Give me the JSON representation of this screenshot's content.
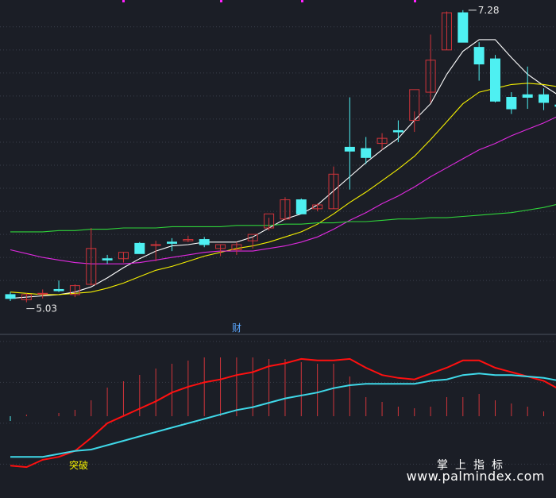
{
  "colors": {
    "background": "#1b1e26",
    "grid": "#3a3f4b",
    "up": "#d1343a",
    "down": "#4ef0f2",
    "ma5": "#ffffff",
    "ma10": "#f5f000",
    "ma20": "#e02ae0",
    "ma60": "#2fd43a",
    "osc_fast": "#ff1010",
    "osc_slow": "#3fd8e8",
    "hist": "#d1343a",
    "marker": "#ff22ff",
    "label": "#e8e8e8",
    "signal": "#f5f000",
    "divider_text": "#5aa7ff"
  },
  "annotations": {
    "high_label": "7.28",
    "low_label": "5.03",
    "finance_marker": "财",
    "signal_label": "突破"
  },
  "watermark": {
    "title": "掌上指标",
    "url": "www.palmindex.com"
  },
  "chart_data": [
    {
      "type": "candlestick",
      "title": "",
      "ylim": [
        4.85,
        7.33
      ],
      "y_gridlines": [
        5.19,
        5.37,
        5.55,
        5.73,
        5.91,
        6.09,
        6.27,
        6.45,
        6.63,
        6.81,
        6.99,
        7.17
      ],
      "candles": [
        {
          "o": 5.08,
          "h": 5.1,
          "l": 5.03,
          "c": 5.05
        },
        {
          "o": 5.04,
          "h": 5.09,
          "l": 5.02,
          "c": 5.08
        },
        {
          "o": 5.09,
          "h": 5.12,
          "l": 5.05,
          "c": 5.09
        },
        {
          "o": 5.12,
          "h": 5.19,
          "l": 5.1,
          "c": 5.11
        },
        {
          "o": 5.08,
          "h": 5.16,
          "l": 5.06,
          "c": 5.15
        },
        {
          "o": 5.16,
          "h": 5.6,
          "l": 5.15,
          "c": 5.44
        },
        {
          "o": 5.36,
          "h": 5.39,
          "l": 5.32,
          "c": 5.35
        },
        {
          "o": 5.36,
          "h": 5.41,
          "l": 5.33,
          "c": 5.41
        },
        {
          "o": 5.48,
          "h": 5.49,
          "l": 5.4,
          "c": 5.4
        },
        {
          "o": 5.47,
          "h": 5.5,
          "l": 5.34,
          "c": 5.47
        },
        {
          "o": 5.49,
          "h": 5.52,
          "l": 5.42,
          "c": 5.48
        },
        {
          "o": 5.5,
          "h": 5.54,
          "l": 5.49,
          "c": 5.51
        },
        {
          "o": 5.51,
          "h": 5.53,
          "l": 5.45,
          "c": 5.47
        },
        {
          "o": 5.44,
          "h": 5.47,
          "l": 5.38,
          "c": 5.47
        },
        {
          "o": 5.43,
          "h": 5.49,
          "l": 5.39,
          "c": 5.47
        },
        {
          "o": 5.5,
          "h": 5.53,
          "l": 5.44,
          "c": 5.55
        },
        {
          "o": 5.6,
          "h": 5.68,
          "l": 5.58,
          "c": 5.71
        },
        {
          "o": 5.67,
          "h": 5.84,
          "l": 5.66,
          "c": 5.82
        },
        {
          "o": 5.82,
          "h": 5.83,
          "l": 5.75,
          "c": 5.71
        },
        {
          "o": 5.75,
          "h": 5.79,
          "l": 5.73,
          "c": 5.78
        },
        {
          "o": 5.75,
          "h": 6.08,
          "l": 5.75,
          "c": 6.02
        },
        {
          "o": 6.23,
          "h": 6.62,
          "l": 5.9,
          "c": 6.2
        },
        {
          "o": 6.22,
          "h": 6.31,
          "l": 6.1,
          "c": 6.15
        },
        {
          "o": 6.26,
          "h": 6.34,
          "l": 6.21,
          "c": 6.3
        },
        {
          "o": 6.36,
          "h": 6.44,
          "l": 6.27,
          "c": 6.35
        },
        {
          "o": 6.44,
          "h": 6.51,
          "l": 6.35,
          "c": 6.68
        },
        {
          "o": 6.66,
          "h": 7.11,
          "l": 6.58,
          "c": 6.91
        },
        {
          "o": 6.99,
          "h": 7.29,
          "l": 6.99,
          "c": 7.28
        },
        {
          "o": 7.28,
          "h": 7.3,
          "l": 7.09,
          "c": 7.05
        },
        {
          "o": 7.01,
          "h": 7.05,
          "l": 6.75,
          "c": 6.88
        },
        {
          "o": 6.92,
          "h": 6.95,
          "l": 6.58,
          "c": 6.59
        },
        {
          "o": 6.62,
          "h": 6.66,
          "l": 6.49,
          "c": 6.53
        },
        {
          "o": 6.64,
          "h": 6.86,
          "l": 6.53,
          "c": 6.62
        },
        {
          "o": 6.64,
          "h": 6.69,
          "l": 6.52,
          "c": 6.58
        },
        {
          "o": 6.56,
          "h": 6.63,
          "l": 6.47,
          "c": 6.55
        }
      ],
      "ma": [
        {
          "name": "MA5",
          "color_key": "ma5",
          "values": [
            5.05,
            5.06,
            5.07,
            5.08,
            5.1,
            5.14,
            5.21,
            5.29,
            5.36,
            5.42,
            5.46,
            5.47,
            5.49,
            5.49,
            5.49,
            5.53,
            5.6,
            5.67,
            5.71,
            5.78,
            5.89,
            6.0,
            6.11,
            6.21,
            6.3,
            6.44,
            6.57,
            6.8,
            6.98,
            7.07,
            7.07,
            6.93,
            6.8,
            6.71,
            6.63
          ]
        },
        {
          "name": "MA10",
          "color_key": "ma10",
          "values": [
            5.1,
            5.09,
            5.08,
            5.08,
            5.09,
            5.1,
            5.13,
            5.17,
            5.22,
            5.27,
            5.3,
            5.34,
            5.38,
            5.41,
            5.44,
            5.46,
            5.49,
            5.53,
            5.57,
            5.63,
            5.71,
            5.8,
            5.88,
            5.97,
            6.06,
            6.16,
            6.29,
            6.43,
            6.57,
            6.66,
            6.69,
            6.72,
            6.73,
            6.72,
            6.7
          ]
        },
        {
          "name": "MA20",
          "color_key": "ma20",
          "values": [
            5.43,
            5.4,
            5.37,
            5.35,
            5.33,
            5.32,
            5.32,
            5.32,
            5.33,
            5.35,
            5.37,
            5.39,
            5.41,
            5.42,
            5.42,
            5.42,
            5.44,
            5.46,
            5.49,
            5.53,
            5.59,
            5.66,
            5.72,
            5.79,
            5.85,
            5.92,
            6.0,
            6.07,
            6.14,
            6.21,
            6.26,
            6.32,
            6.37,
            6.42,
            6.48
          ]
        },
        {
          "name": "MA60",
          "color_key": "ma60",
          "values": [
            5.57,
            5.57,
            5.57,
            5.58,
            5.58,
            5.59,
            5.59,
            5.6,
            5.6,
            5.6,
            5.61,
            5.61,
            5.61,
            5.61,
            5.62,
            5.62,
            5.62,
            5.63,
            5.63,
            5.64,
            5.64,
            5.65,
            5.65,
            5.66,
            5.67,
            5.67,
            5.68,
            5.68,
            5.69,
            5.7,
            5.71,
            5.72,
            5.74,
            5.76,
            5.79
          ]
        }
      ]
    },
    {
      "type": "line",
      "title": "",
      "ylim": [
        0,
        100
      ],
      "y_gridlines": [
        15,
        43,
        71,
        99
      ],
      "x_sampled": [
        0,
        1,
        2,
        3,
        4,
        5,
        6,
        7,
        8,
        9,
        10,
        11,
        12,
        13,
        14,
        15,
        16,
        17,
        18,
        19,
        20,
        21,
        22,
        23,
        24,
        25,
        26,
        27,
        28,
        29,
        30,
        31,
        32,
        33,
        34
      ],
      "series": [
        {
          "color_key": "osc_fast",
          "values": [
            14,
            13,
            18,
            20,
            24,
            33,
            43,
            48,
            53,
            58,
            64,
            68,
            71,
            73,
            76,
            78,
            82,
            84,
            87,
            86,
            86,
            87,
            81,
            76,
            74,
            73,
            77,
            81,
            86,
            86,
            81,
            78,
            75,
            72,
            66
          ]
        },
        {
          "color_key": "osc_slow",
          "values": [
            20,
            20,
            20,
            22,
            24,
            25,
            28,
            31,
            34,
            37,
            40,
            43,
            46,
            49,
            52,
            54,
            57,
            60,
            62,
            64,
            67,
            69,
            70,
            70,
            70,
            70,
            72,
            73,
            76,
            77,
            76,
            76,
            75,
            74,
            72
          ]
        }
      ],
      "histogram": [
        -3,
        1,
        0,
        2,
        4,
        10,
        18,
        22,
        26,
        30,
        33,
        35,
        37,
        37,
        37,
        37,
        36,
        36,
        34,
        33,
        33,
        25,
        12,
        9,
        6,
        5,
        6,
        12,
        12,
        14,
        10,
        8,
        6,
        3,
        1
      ],
      "signal_index": 3
    }
  ]
}
